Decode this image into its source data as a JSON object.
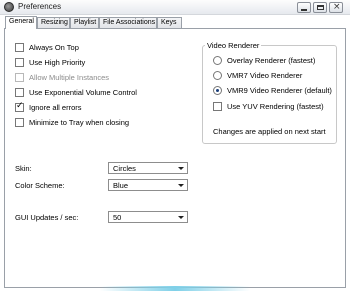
{
  "window": {
    "title": "Preferences"
  },
  "tabs": [
    "General",
    "Resizing",
    "Playlist",
    "File Associations",
    "Keys"
  ],
  "options": [
    {
      "label": "Always On Top",
      "checked": false,
      "disabled": false
    },
    {
      "label": "Use High Priority",
      "checked": false,
      "disabled": false
    },
    {
      "label": "Allow  Multiple Instances",
      "checked": false,
      "disabled": true
    },
    {
      "label": "Use Exponential Volume Control",
      "checked": false,
      "disabled": false
    },
    {
      "label": "Ignore all errors",
      "checked": true,
      "disabled": false
    },
    {
      "label": "Minimize to Tray when closing",
      "checked": false,
      "disabled": false
    }
  ],
  "video_renderer": {
    "title": "Video Renderer",
    "options": [
      {
        "label": "Overlay Renderer (fastest)",
        "selected": false
      },
      {
        "label": "VMR7 Video Renderer",
        "selected": false
      },
      {
        "label": "VMR9 Video Renderer (default)",
        "selected": true
      }
    ],
    "yuv_label": "Use YUV Rendering (fastest)",
    "yuv_checked": false,
    "note": "Changes are applied on next start"
  },
  "skin": {
    "label": "Skin:",
    "value": "Circles"
  },
  "color_scheme": {
    "label": "Color Scheme:",
    "value": "Blue"
  },
  "gui_updates": {
    "label": "GUI Updates / sec:",
    "value": "50"
  }
}
